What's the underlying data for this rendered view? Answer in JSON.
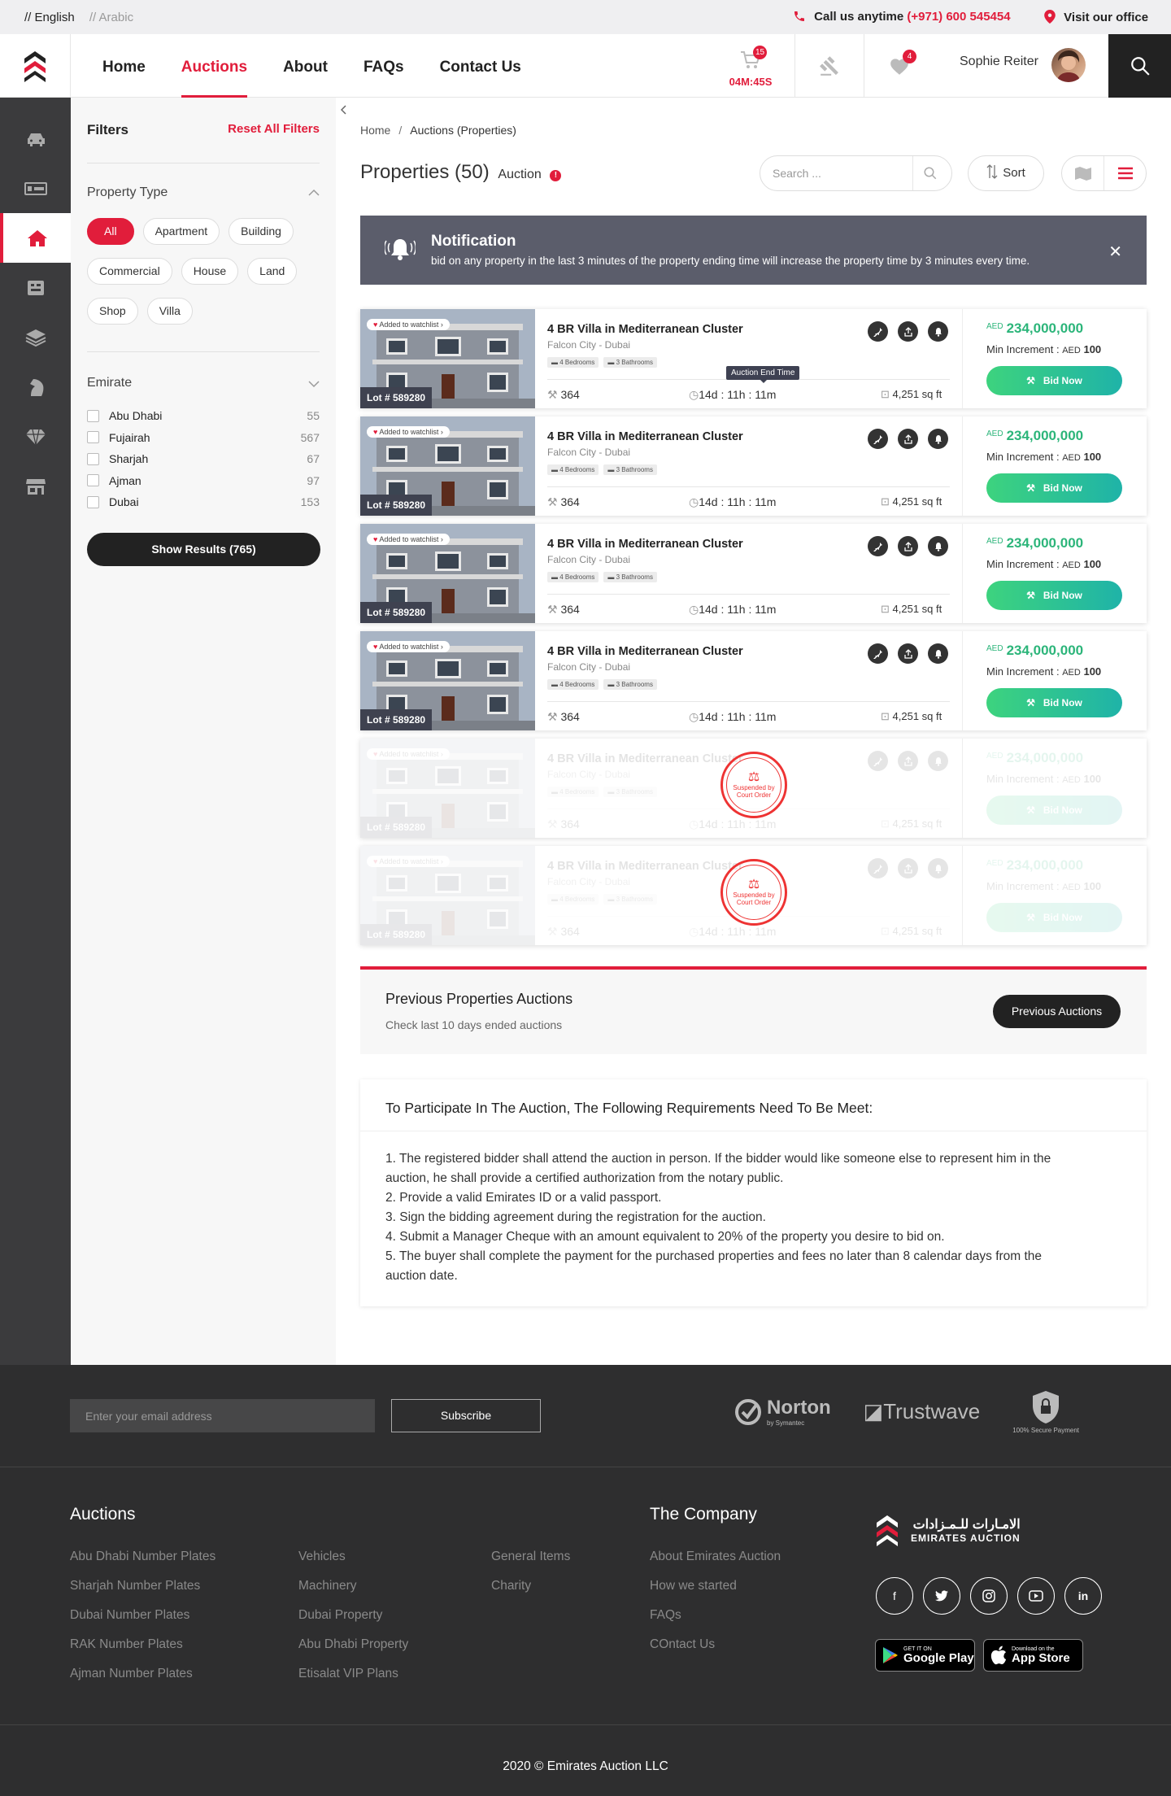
{
  "topbar": {
    "lang_en": "// English",
    "lang_ar": "// Arabic",
    "call_label": "Call us anytime",
    "call_number": "(+971) 600 545454",
    "visit_label": "Visit our office"
  },
  "nav": {
    "items": [
      "Home",
      "Auctions",
      "About",
      "FAQs",
      "Contact Us"
    ],
    "active": "Auctions",
    "cart_count": "15",
    "cart_timer": "04M:45S",
    "fav_count": "4",
    "user_name": "Sophie Reiter"
  },
  "filters": {
    "title": "Filters",
    "reset": "Reset All Filters",
    "property_type_label": "Property Type",
    "property_types": [
      "All",
      "Apartment",
      "Building",
      "Commercial",
      "House",
      "Land",
      "Shop",
      "Villa"
    ],
    "emirate_label": "Emirate",
    "emirates": [
      {
        "name": "Abu Dhabi",
        "count": "55"
      },
      {
        "name": "Fujairah",
        "count": "567"
      },
      {
        "name": "Sharjah",
        "count": "67"
      },
      {
        "name": "Ajman",
        "count": "97"
      },
      {
        "name": "Dubai",
        "count": "153"
      }
    ],
    "show_results": "Show Results (765)"
  },
  "breadcrumb": {
    "home": "Home",
    "current": "Auctions (Properties)"
  },
  "page": {
    "title": "Properties (50)",
    "subtitle": "Auction",
    "search_placeholder": "Search ...",
    "sort": "Sort"
  },
  "notification": {
    "title": "Notification",
    "body": "bid on any property in the last 3 minutes of the property ending time will increase the property time by 3 minutes every time."
  },
  "cards": [
    {
      "watch": "Added to watchlist",
      "lot": "Lot # 589280",
      "title": "4 BR Villa in Mediterranean Cluster",
      "location": "Falcon City - Dubai",
      "bedrooms": "4 Bedrooms",
      "bathrooms": "3 Bathrooms",
      "bids": "364",
      "time": "14d : 11h : 11m",
      "area": "4,251 sq ft",
      "currency": "AED",
      "price": "234,000,000",
      "min_inc_label": "Min Increment :",
      "min_inc_cur": "AED",
      "min_inc": "100",
      "bid": "Bid Now"
    },
    {
      "watch": "Added to watchlist",
      "lot": "Lot # 589280",
      "title": "4 BR Villa in Mediterranean Cluster",
      "location": "Falcon City - Dubai",
      "bedrooms": "4 Bedrooms",
      "bathrooms": "3 Bathrooms",
      "bids": "364",
      "time": "14d : 11h : 11m",
      "area": "4,251 sq ft",
      "currency": "AED",
      "price": "234,000,000",
      "min_inc_label": "Min Increment :",
      "min_inc_cur": "AED",
      "min_inc": "100",
      "bid": "Bid Now"
    },
    {
      "watch": "Added to watchlist",
      "lot": "Lot # 589280",
      "title": "4 BR Villa in Mediterranean Cluster",
      "location": "Falcon City - Dubai",
      "bedrooms": "4 Bedrooms",
      "bathrooms": "3 Bathrooms",
      "bids": "364",
      "time": "14d : 11h : 11m",
      "area": "4,251 sq ft",
      "currency": "AED",
      "price": "234,000,000",
      "min_inc_label": "Min Increment :",
      "min_inc_cur": "AED",
      "min_inc": "100",
      "bid": "Bid Now"
    },
    {
      "watch": "Added to watchlist",
      "lot": "Lot # 589280",
      "title": "4 BR Villa in Mediterranean Cluster",
      "location": "Falcon City - Dubai",
      "bedrooms": "4 Bedrooms",
      "bathrooms": "3 Bathrooms",
      "bids": "364",
      "time": "14d : 11h : 11m",
      "area": "4,251 sq ft",
      "currency": "AED",
      "price": "234,000,000",
      "min_inc_label": "Min Increment :",
      "min_inc_cur": "AED",
      "min_inc": "100",
      "bid": "Bid Now"
    },
    {
      "watch": "Added to watchlist",
      "lot": "Lot # 589280",
      "title": "4 BR Villa in Mediterranean Cluster",
      "location": "Falcon City - Dubai",
      "bedrooms": "4 Bedrooms",
      "bathrooms": "3 Bathrooms",
      "bids": "364",
      "time": "14d : 11h : 11m",
      "area": "4,251 sq ft",
      "currency": "AED",
      "price": "234,000,000",
      "min_inc_label": "Min Increment :",
      "min_inc_cur": "AED",
      "min_inc": "100",
      "bid": "Bid Now",
      "stamp": "Suspended by Court Order"
    },
    {
      "watch": "Added to watchlist",
      "lot": "Lot # 589280",
      "title": "4 BR Villa in Mediterranean Cluster",
      "location": "Falcon City - Dubai",
      "bedrooms": "4 Bedrooms",
      "bathrooms": "3 Bathrooms",
      "bids": "364",
      "time": "14d : 11h : 11m",
      "area": "4,251 sq ft",
      "currency": "AED",
      "price": "234,000,000",
      "min_inc_label": "Min Increment :",
      "min_inc_cur": "AED",
      "min_inc": "100",
      "bid": "Bid Now",
      "stamp": "Suspended by Court Order"
    }
  ],
  "tooltip": "Auction End Time",
  "previous": {
    "title": "Previous Properties Auctions",
    "subtitle": "Check last 10 days ended auctions",
    "button": "Previous Auctions"
  },
  "requirements": {
    "title": "To Participate In The Auction, The Following Requirements Need To Be Meet:",
    "items": [
      "1. The registered bidder shall attend the auction in person. If the bidder would like someone else to represent him in the auction, he shall provide a certified authorization from the notary public.",
      "2. Provide a valid Emirates ID or a valid passport.",
      "3. Sign the bidding agreement during the registration for the auction.",
      "4. Submit a Manager Cheque with an amount equivalent to 20% of the property you desire to bid on.",
      "5. The buyer shall complete the payment for the purchased properties and fees no later than 8 calendar days from the auction date."
    ]
  },
  "footer": {
    "email_placeholder": "Enter your email address",
    "subscribe": "Subscribe",
    "norton": "Norton",
    "norton_sub": "by Symantec",
    "trustwave": "Trustwave",
    "secure": "100% Secure Payment",
    "auctions_title": "Auctions",
    "auctions_col1": [
      "Abu Dhabi Number Plates",
      "Sharjah Number Plates",
      "Dubai Number Plates",
      "RAK Number Plates",
      "Ajman Number Plates"
    ],
    "auctions_col2": [
      "Vehicles",
      "Machinery",
      "Dubai Property",
      "Abu Dhabi Property",
      "Etisalat VIP Plans"
    ],
    "auctions_col3": [
      "General Items",
      "Charity"
    ],
    "company_title": "The Company",
    "company_links": [
      "About Emirates Auction",
      "How we started",
      "FAQs",
      "COntact Us"
    ],
    "brand_ar": "الامـارات للـمـزادات",
    "brand_en": "EMIRATES AUCTION",
    "google_small": "GET IT ON",
    "google": "Google Play",
    "apple_small": "Download on the",
    "apple": "App Store",
    "copyright": "2020 © Emirates Auction LLC"
  },
  "colors": {
    "brand_red": "#e11d3b",
    "price_green": "#2cb57a",
    "dark": "#2e2e2f"
  }
}
